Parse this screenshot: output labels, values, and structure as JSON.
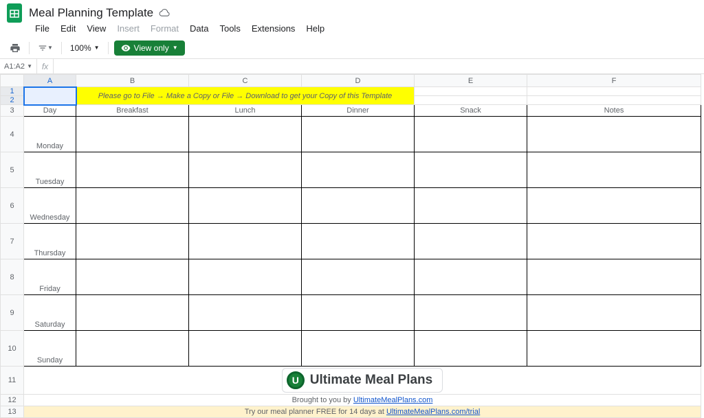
{
  "doc": {
    "title": "Meal Planning Template"
  },
  "menu": {
    "file": "File",
    "edit": "Edit",
    "view": "View",
    "insert": "Insert",
    "format": "Format",
    "data": "Data",
    "tools": "Tools",
    "extensions": "Extensions",
    "help": "Help"
  },
  "toolbar": {
    "zoom": "100%",
    "view_only": "View only"
  },
  "formulabar": {
    "namebox": "A1:A2"
  },
  "columns": {
    "A": "A",
    "B": "B",
    "C": "C",
    "D": "D",
    "E": "E",
    "F": "F"
  },
  "banner": "Please go to File → Make a Copy or File → Download to get your Copy of this Template",
  "headers": {
    "day": "Day",
    "breakfast": "Breakfast",
    "lunch": "Lunch",
    "dinner": "Dinner",
    "snack": "Snack",
    "notes": "Notes"
  },
  "days": {
    "mon": "Monday",
    "tue": "Tuesday",
    "wed": "Wednesday",
    "thu": "Thursday",
    "fri": "Friday",
    "sat": "Saturday",
    "sun": "Sunday"
  },
  "logo_text": "Ultimate Meal Plans",
  "footer": {
    "brought_prefix": "Brought to you by ",
    "brought_link": "UltimateMealPlans.com",
    "trial_prefix": "Try our meal planner FREE for 14 days at ",
    "trial_link": "UltimateMealPlans.com/trial"
  },
  "rownums": [
    "1",
    "2",
    "3",
    "4",
    "5",
    "6",
    "7",
    "8",
    "9",
    "10",
    "11",
    "12",
    "13"
  ]
}
